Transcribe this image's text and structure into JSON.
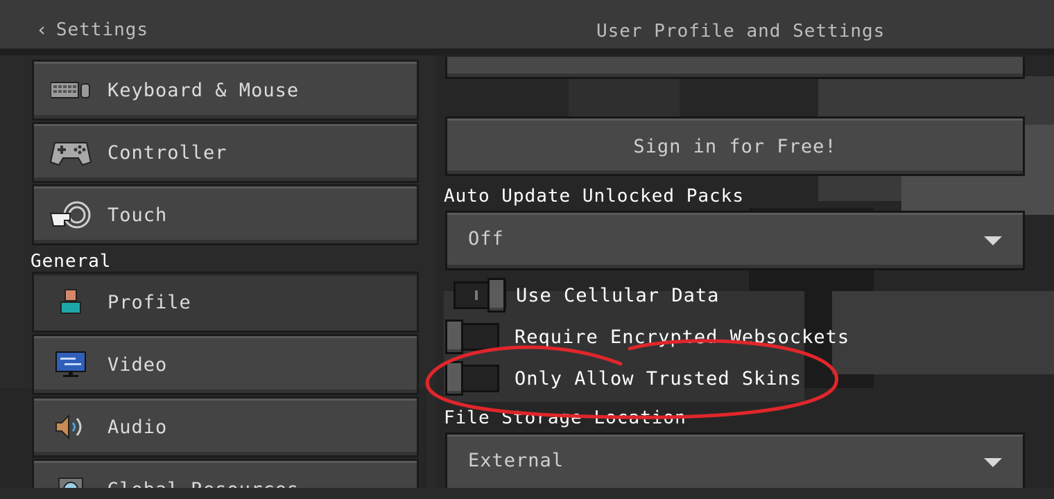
{
  "header": {
    "back_label": "Settings",
    "title": "User Profile and Settings"
  },
  "sidebar": {
    "items_top": [
      {
        "label": "Keyboard & Mouse",
        "icon": "keyboard-mouse-icon"
      },
      {
        "label": "Controller",
        "icon": "gamepad-icon"
      },
      {
        "label": "Touch",
        "icon": "touch-hand-icon"
      }
    ],
    "section_label": "General",
    "items_general": [
      {
        "label": "Profile",
        "icon": "profile-icon",
        "selected": true
      },
      {
        "label": "Video",
        "icon": "monitor-icon"
      },
      {
        "label": "Audio",
        "icon": "speaker-icon"
      },
      {
        "label": "Global Resources",
        "icon": "global-resources-icon"
      }
    ]
  },
  "main": {
    "sign_in_button": "Sign in for Free!",
    "auto_update": {
      "label": "Auto Update Unlocked Packs",
      "value": "Off"
    },
    "toggles": [
      {
        "label": "Use Cellular Data",
        "on": true
      },
      {
        "label": "Require Encrypted Websockets",
        "on": false
      },
      {
        "label": "Only Allow Trusted Skins",
        "on": false
      }
    ],
    "file_storage": {
      "label": "File Storage Location",
      "value": "External"
    }
  },
  "colors": {
    "annotation": "#e0262b",
    "profile_accent": "#1fa7a8"
  }
}
